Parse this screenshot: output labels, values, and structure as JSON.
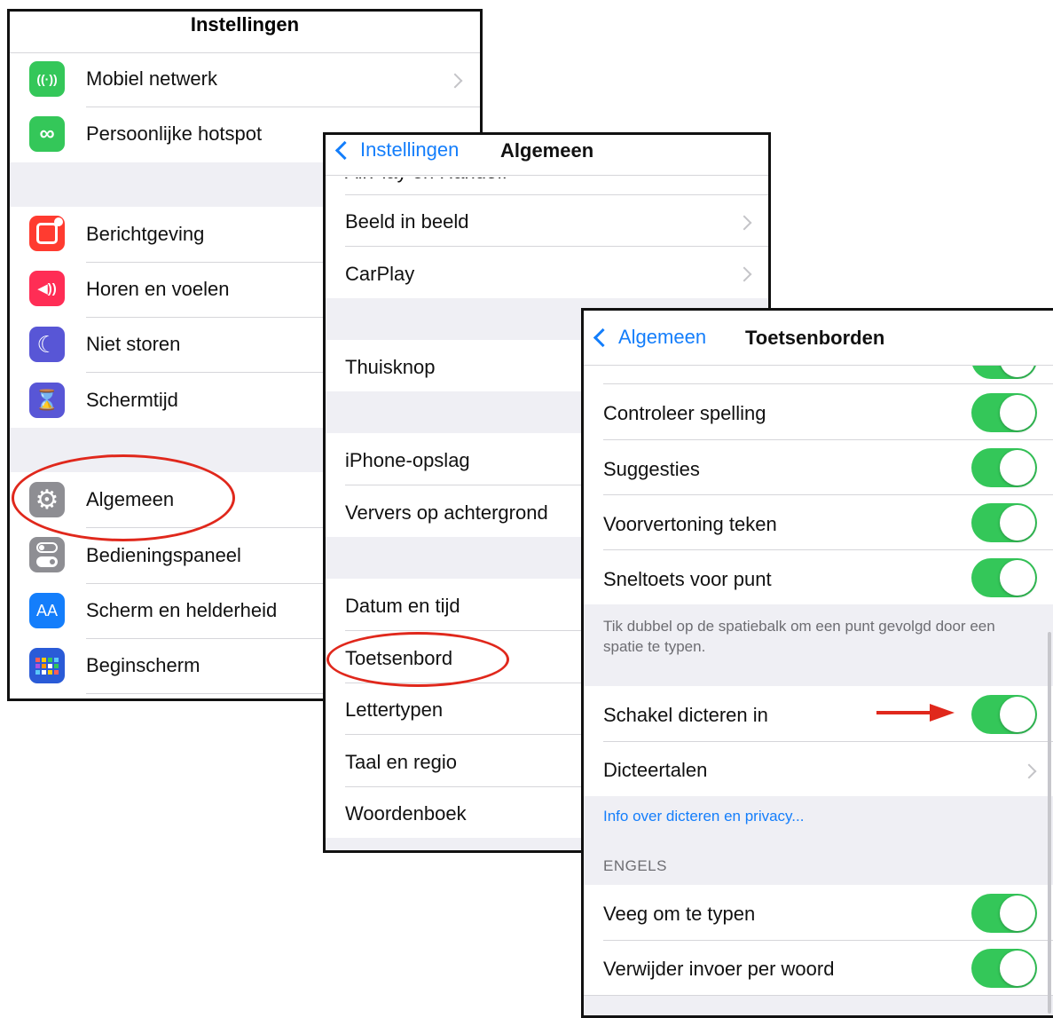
{
  "panel1": {
    "title": "Instellingen",
    "items": [
      {
        "label": "Mobiel netwerk",
        "icon": "antenna-icon",
        "color": "#34c759",
        "glyph": "((·))"
      },
      {
        "label": "Persoonlijke hotspot",
        "icon": "hotspot-icon",
        "color": "#34c759",
        "glyph": "∞"
      },
      {
        "label": "Berichtgeving",
        "icon": "notifications-icon",
        "color": "#ff3b30",
        "glyph": "▢"
      },
      {
        "label": "Horen en voelen",
        "icon": "speaker-icon",
        "color": "#ff2d55",
        "glyph": "◀))"
      },
      {
        "label": "Niet storen",
        "icon": "moon-icon",
        "color": "#5856d6",
        "glyph": "☾"
      },
      {
        "label": "Schermtijd",
        "icon": "hourglass-icon",
        "color": "#5856d6",
        "glyph": "⌛"
      },
      {
        "label": "Algemeen",
        "icon": "gear-icon",
        "color": "#8e8e93",
        "glyph": "⚙"
      },
      {
        "label": "Bedieningspaneel",
        "icon": "switches-icon",
        "color": "#8e8e93",
        "glyph": "☰"
      },
      {
        "label": "Scherm en helderheid",
        "icon": "text-size-icon",
        "color": "#147efb",
        "glyph": "AA"
      },
      {
        "label": "Beginscherm",
        "icon": "home-grid-icon",
        "color": "#2a5bd7",
        "glyph": "⋮⋮"
      }
    ]
  },
  "panel2": {
    "back_label": "Instellingen",
    "title": "Algemeen",
    "cut_item": "AirPlay en Handoff",
    "items": [
      {
        "label": "Beeld in beeld"
      },
      {
        "label": "CarPlay"
      },
      {
        "label": "Thuisknop"
      },
      {
        "label": "iPhone-opslag"
      },
      {
        "label": "Ververs op achtergrond"
      },
      {
        "label": "Datum en tijd"
      },
      {
        "label": "Toetsenbord"
      },
      {
        "label": "Lettertypen"
      },
      {
        "label": "Taal en regio"
      },
      {
        "label": "Woordenboek"
      }
    ]
  },
  "panel3": {
    "back_label": "Algemeen",
    "title": "Toetsenborden",
    "toggles_top": [
      {
        "label": "Controleer spelling",
        "on": true
      },
      {
        "label": "Suggesties",
        "on": true
      },
      {
        "label": "Voorvertoning teken",
        "on": true
      },
      {
        "label": "Sneltoets voor punt",
        "on": true
      }
    ],
    "footnote": "Tik dubbel op de spatiebalk om een punt gevolgd door een spatie te typen.",
    "dictation_label": "Schakel dicteren in",
    "dictation_on": true,
    "languages_label": "Dicteertalen",
    "privacy_link": "Info over dicteren en privacy...",
    "section_header": "ENGELS",
    "toggles_bottom": [
      {
        "label": "Veeg om te typen",
        "on": true
      },
      {
        "label": "Verwijder invoer per woord",
        "on": true
      }
    ]
  },
  "colors": {
    "accent": "#147efb",
    "toggle_on": "#34c759",
    "annotation": "#e0281c"
  }
}
